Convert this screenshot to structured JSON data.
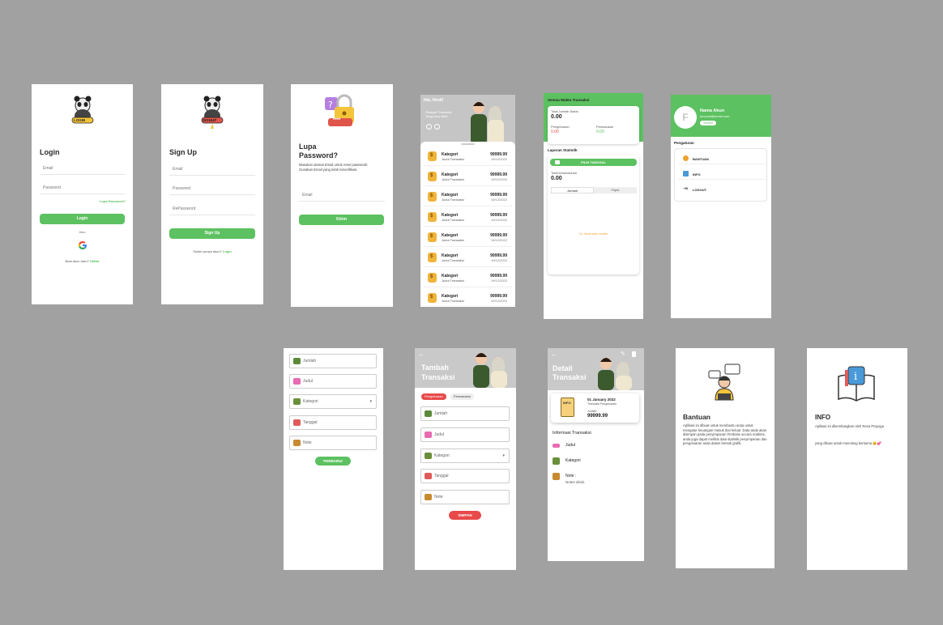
{
  "login": {
    "title": "Login",
    "email": "Email",
    "password": "Password",
    "forgot": "Lupa Password?",
    "button": "Login",
    "or": "Atau",
    "no_account": "Buat akun baru?",
    "register": "Daftar",
    "badge": "LOGIN"
  },
  "signup": {
    "title": "Sign Up",
    "email": "Email",
    "password": "Password",
    "repassword": "RePassword",
    "button": "Sign Up",
    "have_account": "Sudah punya akun?",
    "login": "Login",
    "badge": "SIGNUP"
  },
  "forgot": {
    "title1": "Lupa",
    "title2": "Password?",
    "desc": "Masukan alamat Email untuk reset password! Gunakan Email yang telah terverifikasi",
    "email": "Email",
    "button": "Kirim",
    "pin": "****"
  },
  "home": {
    "greeting": "Hai, Hesti!",
    "hero_line1": "Riwayat Transaksi",
    "hero_line2": "Yang baru diliat",
    "rows": [
      {
        "cat": "Kategori",
        "sub": "Judul Transaksi",
        "amt": "99999.99",
        "date": "19/12/2022"
      },
      {
        "cat": "Kategori",
        "sub": "Judul Transaksi",
        "amt": "99999.99",
        "date": "19/12/2022"
      },
      {
        "cat": "Kategori",
        "sub": "Judul Transaksi",
        "amt": "99999.99",
        "date": "19/12/2022"
      },
      {
        "cat": "Kategori",
        "sub": "Judul Transaksi",
        "amt": "99999.99",
        "date": "19/12/2022"
      },
      {
        "cat": "Kategori",
        "sub": "Judul Transaksi",
        "amt": "99999.99",
        "date": "19/12/2022"
      },
      {
        "cat": "Kategori",
        "sub": "Judul Transaksi",
        "amt": "99999.99",
        "date": "19/12/2022"
      },
      {
        "cat": "Kategori",
        "sub": "Judul Transaksi",
        "amt": "99999.99",
        "date": "19/12/2022"
      },
      {
        "cat": "Kategori",
        "sub": "Judul Transaksi",
        "amt": "99999.99",
        "date": "19/12/2022"
      }
    ]
  },
  "stats": {
    "header": "Semua Waktu Transaksi",
    "total_label": "Total Jumlah Saldo",
    "total": "0.00",
    "out_label": "Pengeluaran",
    "out": "0.00",
    "in_label": "Pemasukan",
    "in": "0.00",
    "section": "Laporan Statistik",
    "pick": "PILIH TANGGAL",
    "total2_label": "Total Keseluruhan",
    "total2": "0.00",
    "tab1": "Jumlah",
    "tab2": "Pajak",
    "empty": "Yo, tidak ada mobile"
  },
  "account": {
    "name": "Nama Akun",
    "email": "account@email.com",
    "status": "Verified",
    "section": "Pengaturan",
    "help": "BANTUAN",
    "info": "INFO",
    "logout": "LOGOUT",
    "avatar": "F"
  },
  "formA": {
    "jumlah": "Jumlah",
    "judul": "Judul",
    "kategori": "Kategori",
    "tanggal": "Tanggal",
    "note": "Note",
    "button": "PERBARUI"
  },
  "add": {
    "title1": "Tambah",
    "title2": "Transaksi",
    "tab_out": "Pengeluaran",
    "tab_in": "Pemasukan",
    "jumlah": "Jumlah",
    "judul": "Judul",
    "kategori": "Kategori",
    "tanggal": "Tanggal",
    "note": "Note",
    "button": "SIMPAN"
  },
  "detail": {
    "title1": "Detail",
    "title2": "Transaksi",
    "date": "01 January 2022",
    "type": "Transaksi Pengeluaran",
    "amount_label": "Jumlah",
    "amount": "99999.99",
    "section": "Informasi Transaksi",
    "judul": "Judul",
    "kategori": "Kategori",
    "note_label": "Note :",
    "note": "Notes disini.",
    "doc": "INFO"
  },
  "help": {
    "title": "Bantuan",
    "body": "Aplikasi ini dibuat untuk membantu anda untuk mengatur keuangan masuk dan keluar. Data anda akan disimpan pada penyimpanan Firebase secara realtime, anda juga dapat melihat data statistik penyimpanan dan pengeluaran anda dalam bentuk grafik."
  },
  "info": {
    "title": "INFO",
    "line1": "Aplikasi ini dikembangkan oleh Reza Prayoga",
    "line2": "yang dibuat untuk menolong bersama 😉💕"
  },
  "colors": {
    "accent": "#5cc160",
    "danger": "#e84a4a",
    "bg": "#a1a1a1"
  }
}
